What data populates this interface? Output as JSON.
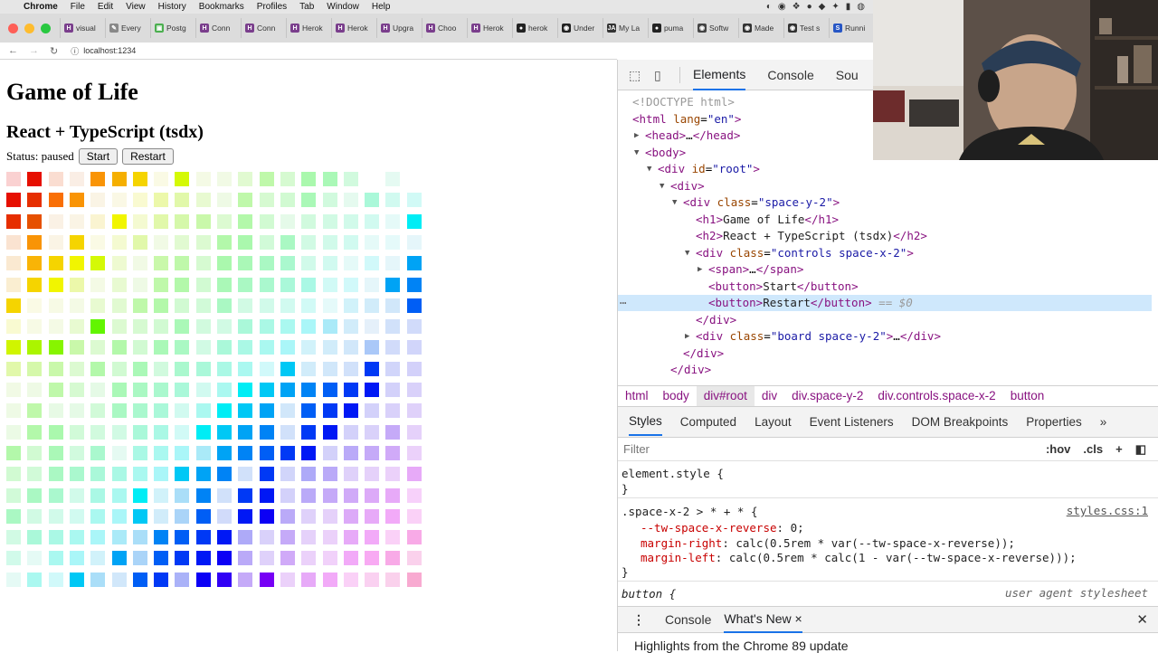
{
  "menubar": {
    "items": [
      "Chrome",
      "File",
      "Edit",
      "View",
      "History",
      "Bookmarks",
      "Profiles",
      "Tab",
      "Window",
      "Help"
    ]
  },
  "tabs": [
    {
      "label": "visual",
      "icon": "H",
      "color": "#7a3e8c"
    },
    {
      "label": "Every",
      "icon": "✎",
      "color": "#888"
    },
    {
      "label": "Postg",
      "icon": "▣",
      "color": "#4caf50"
    },
    {
      "label": "Conn",
      "icon": "H",
      "color": "#7a3e8c"
    },
    {
      "label": "Conn",
      "icon": "H",
      "color": "#7a3e8c"
    },
    {
      "label": "Herok",
      "icon": "H",
      "color": "#7a3e8c"
    },
    {
      "label": "Herok",
      "icon": "H",
      "color": "#7a3e8c"
    },
    {
      "label": "Upgra",
      "icon": "H",
      "color": "#7a3e8c"
    },
    {
      "label": "Choo",
      "icon": "H",
      "color": "#7a3e8c"
    },
    {
      "label": "Herok",
      "icon": "H",
      "color": "#7a3e8c"
    },
    {
      "label": "herok",
      "icon": "●",
      "color": "#222"
    },
    {
      "label": "Under",
      "icon": "◉",
      "color": "#222"
    },
    {
      "label": "My La",
      "icon": "JA",
      "color": "#333"
    },
    {
      "label": "puma",
      "icon": "●",
      "color": "#222"
    },
    {
      "label": "Softw",
      "icon": "◉",
      "color": "#444"
    },
    {
      "label": "Made",
      "icon": "◉",
      "color": "#333"
    },
    {
      "label": "Test s",
      "icon": "◉",
      "color": "#333"
    },
    {
      "label": "Runni",
      "icon": "S",
      "color": "#2756c5"
    }
  ],
  "address": {
    "url": "localhost:1234"
  },
  "page": {
    "title": "Game of Life",
    "subtitle": "React + TypeScript (tsdx)",
    "status_label": "Status: paused",
    "start_label": "Start",
    "restart_label": "Restart"
  },
  "devtools": {
    "tabs": [
      "Elements",
      "Console",
      "Sou"
    ],
    "dom_lines": [
      {
        "indent": 0,
        "arrow": "",
        "html": "<span class='gr'>&lt;!DOCTYPE html&gt;</span>"
      },
      {
        "indent": 0,
        "arrow": "",
        "html": "<span class='tg'>&lt;html</span> <span class='at'>lang</span>=<span class='av'>\"en\"</span><span class='tg'>&gt;</span>"
      },
      {
        "indent": 1,
        "arrow": "▶",
        "html": "<span class='tg'>&lt;head&gt;</span>…<span class='tg'>&lt;/head&gt;</span>"
      },
      {
        "indent": 1,
        "arrow": "▼",
        "html": "<span class='tg'>&lt;body&gt;</span>"
      },
      {
        "indent": 2,
        "arrow": "▼",
        "html": "<span class='tg'>&lt;div</span> <span class='at'>id</span>=<span class='av'>\"root\"</span><span class='tg'>&gt;</span>"
      },
      {
        "indent": 3,
        "arrow": "▼",
        "html": "<span class='tg'>&lt;div&gt;</span>"
      },
      {
        "indent": 4,
        "arrow": "▼",
        "html": "<span class='tg'>&lt;div</span> <span class='at'>class</span>=<span class='av'>\"space-y-2\"</span><span class='tg'>&gt;</span>"
      },
      {
        "indent": 5,
        "arrow": "",
        "html": "<span class='tg'>&lt;h1&gt;</span><span class='tx'>Game of Life</span><span class='tg'>&lt;/h1&gt;</span>"
      },
      {
        "indent": 5,
        "arrow": "",
        "html": "<span class='tg'>&lt;h2&gt;</span><span class='tx'>React + TypeScript (tsdx)</span><span class='tg'>&lt;/h2&gt;</span>"
      },
      {
        "indent": 5,
        "arrow": "▼",
        "html": "<span class='tg'>&lt;div</span> <span class='at'>class</span>=<span class='av'>\"controls space-x-2\"</span><span class='tg'>&gt;</span>"
      },
      {
        "indent": 6,
        "arrow": "▶",
        "html": "<span class='tg'>&lt;span&gt;</span>…<span class='tg'>&lt;/span&gt;</span>"
      },
      {
        "indent": 6,
        "arrow": "",
        "html": "<span class='tg'>&lt;button&gt;</span><span class='tx'>Start</span><span class='tg'>&lt;/button&gt;</span>"
      },
      {
        "indent": 6,
        "arrow": "",
        "html": "<span class='tg'>&lt;button&gt;</span><span class='tx'>Restart</span><span class='tg'>&lt;/button&gt;</span> <span class='gr'>== <i>$0</i></span>",
        "selected": true
      },
      {
        "indent": 5,
        "arrow": "",
        "html": "<span class='tg'>&lt;/div&gt;</span>"
      },
      {
        "indent": 5,
        "arrow": "▶",
        "html": "<span class='tg'>&lt;div</span> <span class='at'>class</span>=<span class='av'>\"board space-y-2\"</span><span class='tg'>&gt;</span>…<span class='tg'>&lt;/div&gt;</span>"
      },
      {
        "indent": 4,
        "arrow": "",
        "html": "<span class='tg'>&lt;/div&gt;</span>"
      },
      {
        "indent": 3,
        "arrow": "",
        "html": "<span class='tg'>&lt;/div&gt;</span>"
      }
    ],
    "breadcrumbs": [
      "html",
      "body",
      "div#root",
      "div",
      "div.space-y-2",
      "div.controls.space-x-2",
      "button"
    ],
    "panes": [
      "Styles",
      "Computed",
      "Layout",
      "Event Listeners",
      "DOM Breakpoints",
      "Properties",
      "»"
    ],
    "filter_placeholder": "Filter",
    "filter_hov": ":hov",
    "filter_cls": ".cls",
    "filter_plus": "+",
    "styles": {
      "element_style_open": "element.style {",
      "close": "}",
      "rule_selector": ".space-x-2 > * + * {",
      "rule_source": "styles.css:1",
      "prop1_name": "--tw-space-x-reverse",
      "prop1_value": ": 0;",
      "prop2_name": "margin-right",
      "prop2_value": ": calc(0.5rem * var(--tw-space-x-reverse));",
      "prop3_name": "margin-left",
      "prop3_value": ": calc(0.5rem * calc(1 - var(--tw-space-x-reverse)));",
      "button_selector": "button {",
      "button_source": "user agent stylesheet"
    },
    "drawer": {
      "menu_glyph": "⋮",
      "tabs": [
        "Console",
        "What's New"
      ],
      "close_tab": "×",
      "close_drawer": "✕",
      "body": "Highlights from the Chrome 89 update"
    }
  },
  "board": {
    "rows": [
      "pRpoObBoOoopPpPPp0o0",
      "RROOoopPPpoPppPpoPpp",
      "RRoopBpPPPpPpoppppoB",
      "pOoBopPoppPPpPpppooo",
      "pOBBOpoPPpPPPPppopoB",
      "pBbPopoPPpPPPPPppoBB",
      "BoooppPPppPppppopppB",
      "poopBpppPppPPPPPpopp",
      "BBBPpPpPPpPPPPpppPpp",
      "PPPpPpPpPPPPpBpppBpp",
      "ooPpoPPPPpPBBBBBBBpp",
      "oPoopPPPpPBBBpBBBppp",
      "oPPpppPPpBBBBpBBppPp",
      "PpPpPoPPPPBBBBBpPPPp",
      "ppPPPPPPBBBpBpPPpppP",
      "pPPpPPBpPBpBBpPPPPPp",
      "PpppPPBpPBpBBPppPPPp",
      "pPPPPPPBBBBPpPppPPpP",
      "poPPpBPBBBBPpPppPPPp",
      "oPpBPpBBPBBPBpPPpppP"
    ]
  }
}
